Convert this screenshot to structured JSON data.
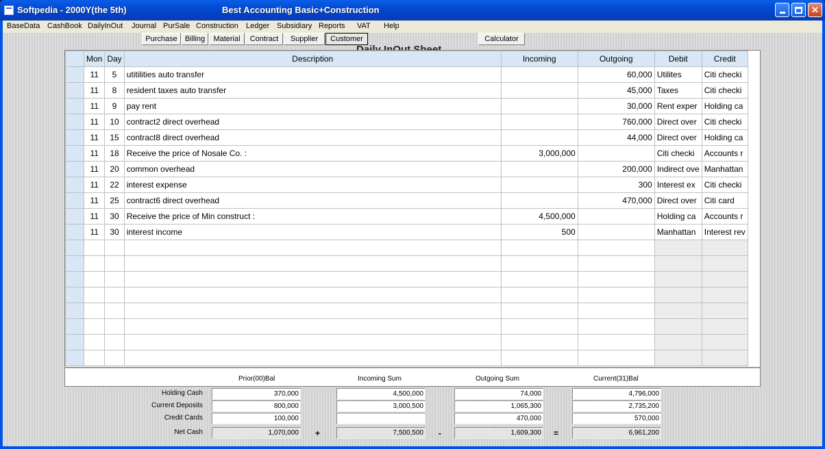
{
  "window": {
    "title": "Softpedia - 2000Y(the 5th)",
    "subtitle": "Best Accounting Basic+Construction"
  },
  "menu": [
    "BaseData",
    "CashBook",
    "DailyInOut",
    "Journal",
    "PurSale",
    "Construction",
    "Ledger",
    "Subsidiary",
    "Reports",
    "VAT",
    "Help"
  ],
  "toolbar": {
    "buttons": [
      "Purchase",
      "Billing",
      "Material",
      "Contract",
      "Supplier",
      "Customer"
    ],
    "pressed": "Customer",
    "calculator": "Calculator"
  },
  "sheet": {
    "title": "Daily InOut Sheet",
    "columns": [
      "Mon",
      "Day",
      "Description",
      "Incoming",
      "Outgoing",
      "Debit",
      "Credit"
    ],
    "rows": [
      {
        "mon": "11",
        "day": "5",
        "desc": "utitilities auto transfer",
        "in": "",
        "out": "60,000",
        "debit": "Utilites",
        "credit": "Citi checki"
      },
      {
        "mon": "11",
        "day": "8",
        "desc": "resident taxes auto transfer",
        "in": "",
        "out": "45,000",
        "debit": "Taxes",
        "credit": "Citi checki"
      },
      {
        "mon": "11",
        "day": "9",
        "desc": "pay rent",
        "in": "",
        "out": "30,000",
        "debit": "Rent exper",
        "credit": "Holding ca"
      },
      {
        "mon": "11",
        "day": "10",
        "desc": "contract2 direct overhead",
        "in": "",
        "out": "760,000",
        "debit": "Direct over",
        "credit": "Citi checki"
      },
      {
        "mon": "11",
        "day": "15",
        "desc": "contract8 direct overhead",
        "in": "",
        "out": "44,000",
        "debit": "Direct over",
        "credit": "Holding ca"
      },
      {
        "mon": "11",
        "day": "18",
        "desc": "Receive the price of Nosale Co. :",
        "in": "3,000,000",
        "out": "",
        "debit": "Citi checki",
        "credit": "Accounts r"
      },
      {
        "mon": "11",
        "day": "20",
        "desc": "common overhead",
        "in": "",
        "out": "200,000",
        "debit": "Indirect ove",
        "credit": "Manhattan"
      },
      {
        "mon": "11",
        "day": "22",
        "desc": "interest expense",
        "in": "",
        "out": "300",
        "debit": "Interest ex",
        "credit": "Citi checki"
      },
      {
        "mon": "11",
        "day": "25",
        "desc": "contract6 direct overhead",
        "in": "",
        "out": "470,000",
        "debit": "Direct over",
        "credit": "Citi card"
      },
      {
        "mon": "11",
        "day": "30",
        "desc": "Receive the price of Min construct :",
        "in": "4,500,000",
        "out": "",
        "debit": "Holding ca",
        "credit": "Accounts r"
      },
      {
        "mon": "11",
        "day": "30",
        "desc": "interest income",
        "in": "500",
        "out": "",
        "debit": "Manhattan",
        "credit": "Interest rev"
      }
    ]
  },
  "summary": {
    "headers": [
      "Prior(00)Bal",
      "Incoming Sum",
      "Outgoing Sum",
      "Current(31)Bal"
    ],
    "rows": [
      {
        "label": "Holding Cash",
        "values": [
          "370,000",
          "4,500,000",
          "74,000",
          "4,796,000"
        ]
      },
      {
        "label": "Current Deposits",
        "values": [
          "800,000",
          "3,000,500",
          "1,065,300",
          "2,735,200"
        ]
      },
      {
        "label": "Credit Cards",
        "values": [
          "100,000",
          "",
          "470,000",
          "570,000"
        ]
      }
    ],
    "net": {
      "label": "Net Cash",
      "values": [
        "1,070,000",
        "7,500,500",
        "1,609,300",
        "6,961,200"
      ]
    },
    "ops": [
      "+",
      "-",
      "="
    ]
  }
}
